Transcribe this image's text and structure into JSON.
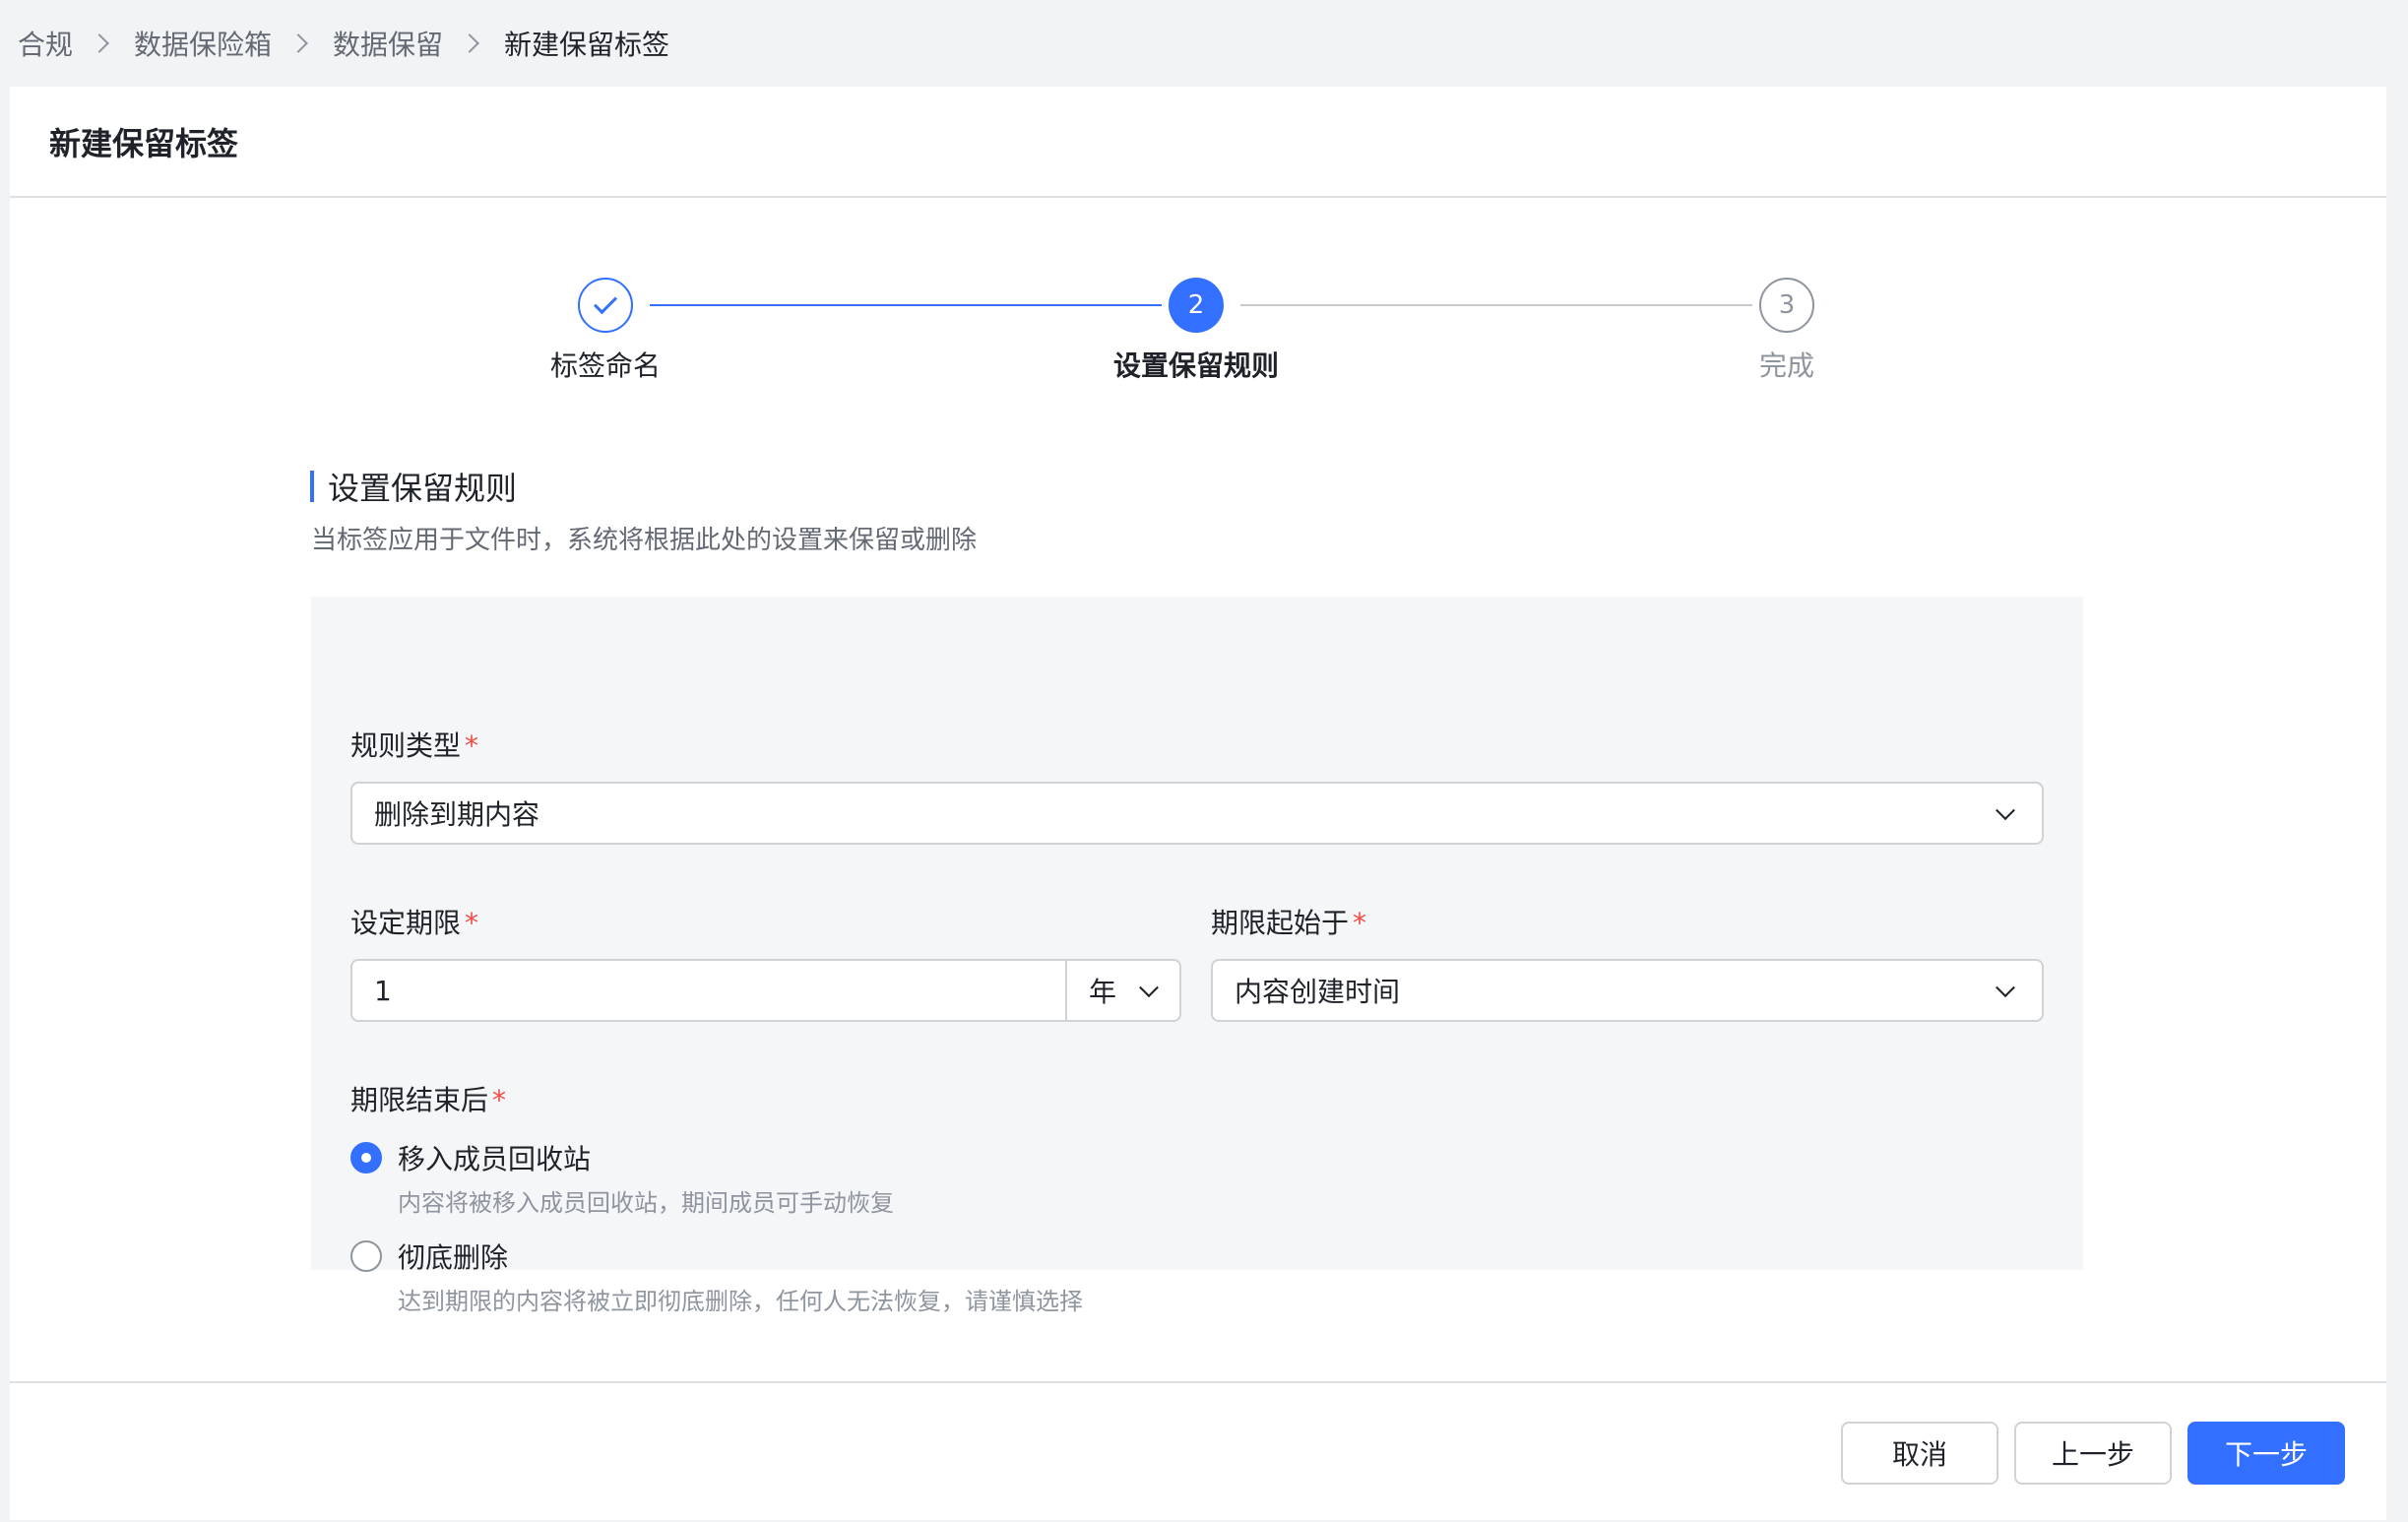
{
  "breadcrumb": {
    "items": [
      "合规",
      "数据保险箱",
      "数据保留",
      "新建保留标签"
    ]
  },
  "page": {
    "title": "新建保留标签"
  },
  "steps": [
    {
      "label": "标签命名",
      "status": "done"
    },
    {
      "label": "设置保留规则",
      "number": "2",
      "status": "active"
    },
    {
      "label": "完成",
      "number": "3",
      "status": "todo"
    }
  ],
  "section": {
    "title": "设置保留规则",
    "description": "当标签应用于文件时，系统将根据此处的设置来保留或删除"
  },
  "form": {
    "rule_type": {
      "label": "规则类型",
      "required_mark": "*",
      "value": "删除到期内容"
    },
    "period": {
      "label": "设定期限",
      "required_mark": "*",
      "value": "1",
      "unit": "年"
    },
    "start": {
      "label": "期限起始于",
      "required_mark": "*",
      "value": "内容创建时间"
    },
    "after_end": {
      "label": "期限结束后",
      "required_mark": "*",
      "options": [
        {
          "label": "移入成员回收站",
          "description": "内容将被移入成员回收站，期间成员可手动恢复",
          "checked": true
        },
        {
          "label": "彻底删除",
          "description": "达到期限的内容将被立即彻底删除，任何人无法恢复，请谨慎选择",
          "checked": false
        }
      ]
    }
  },
  "footer": {
    "cancel_label": "取消",
    "prev_label": "上一步",
    "next_label": "下一步"
  },
  "colors": {
    "accent": "#3370ff",
    "required": "#f54a45"
  }
}
